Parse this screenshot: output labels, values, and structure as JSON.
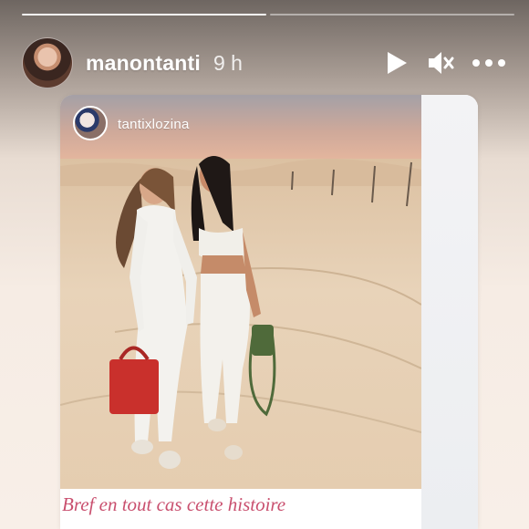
{
  "story": {
    "username": "manontanti",
    "time": "9 h",
    "progress": {
      "segments_total": 2,
      "segments_done": 1
    }
  },
  "icons": {
    "play": "play-icon",
    "mute": "speaker-muted-icon",
    "more": "more-dots-icon"
  },
  "post": {
    "username": "tantixlozina"
  },
  "caption": {
    "line1": "Bref en tout cas cette histoire"
  },
  "colors": {
    "caption_pink": "#c9506f",
    "ui_white": "#ffffff"
  }
}
